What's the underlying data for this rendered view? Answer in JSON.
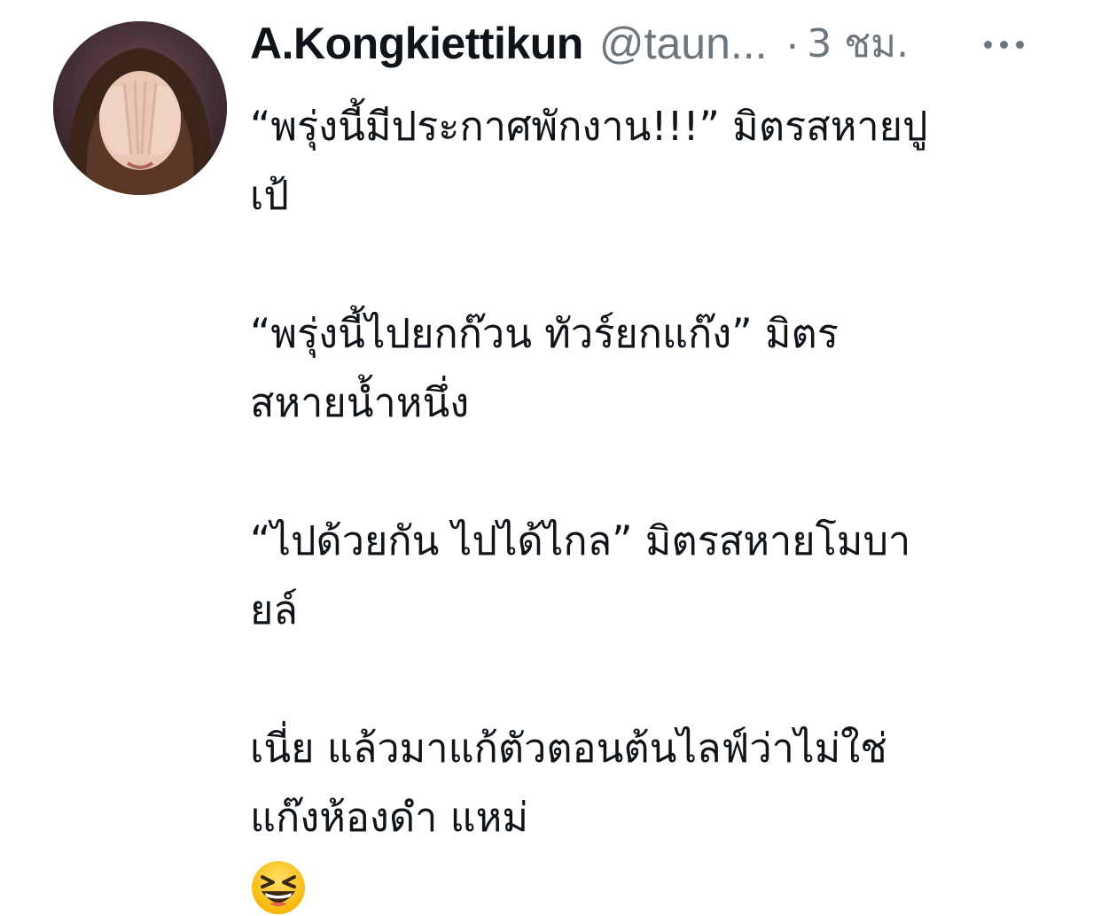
{
  "tweet": {
    "author": {
      "display_name": "A.Kongkiettikun",
      "handle": "@taun...",
      "avatar": "profile-photo"
    },
    "separator": "·",
    "timestamp": "3 ชม.",
    "more_icon": "more-horizontal-icon",
    "paragraphs": [
      {
        "line1": "“พรุ่งนี้มีประกาศพักงาน!!!” มิตรสหายปู",
        "line2": "เป้"
      },
      {
        "line1": "“พรุ่งนี้ไปยกก๊วน ทัวร์ยกแก๊ง” มิตร",
        "line2": "สหายน้ำหนึ่ง"
      },
      {
        "line1": "“ไปด้วยกัน ไปได้ไกล” มิตรสหายโมบา",
        "line2": "ยล์"
      },
      {
        "line1": "เนี่ย แล้วมาแก้ตัวตอนต้นไลฟ์ว่าไม่ใช่",
        "line2": "แก๊งห้องดำ แหม่"
      }
    ],
    "emoji": "grinning-squinting-face"
  }
}
